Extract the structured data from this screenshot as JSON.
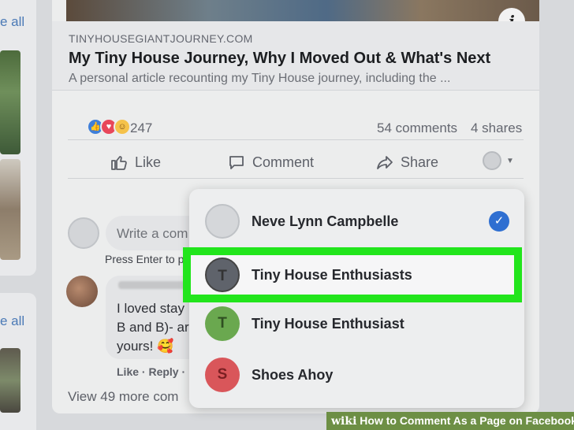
{
  "left": {
    "see_all_top": "e all",
    "see_all_bottom": "e all"
  },
  "post": {
    "info_icon": "i",
    "link": {
      "domain": "TINYHOUSEGIANTJOURNEY.COM",
      "title": "My Tiny House Journey, Why I Moved Out & What's Next",
      "description": "A personal article recounting my Tiny House journey, including the ..."
    },
    "stats": {
      "reaction_count": "247",
      "comments": "54 comments",
      "shares": "4 shares"
    },
    "actions": {
      "like": "Like",
      "comment": "Comment",
      "share": "Share"
    },
    "reaction_icons": [
      "like-icon",
      "love-icon",
      "care-icon"
    ]
  },
  "comment_area": {
    "placeholder": "Write a com",
    "hint": "Press Enter to p",
    "other_comment": "I loved stay\nB and B)- ar\nyours! 🥰",
    "comment_actions": "Like · Reply ·",
    "view_more": "View 49 more com"
  },
  "menu": {
    "items": [
      {
        "label": "Neve Lynn Campbelle",
        "initial": "",
        "color": "#d5d7da",
        "selected": true
      },
      {
        "label": "Tiny House Enthusiasts",
        "initial": "T",
        "color": "#5f636b",
        "selected": false
      },
      {
        "label": "Tiny House Enthusiast",
        "initial": "T",
        "color": "#6aa84f",
        "selected": false
      },
      {
        "label": "Shoes Ahoy",
        "initial": "S",
        "color": "#d9565a",
        "selected": false
      }
    ],
    "highlight_color": "#22e51c"
  },
  "watermark": {
    "brand": "wiki",
    "text": "How to Comment As a Page on Facebook"
  }
}
